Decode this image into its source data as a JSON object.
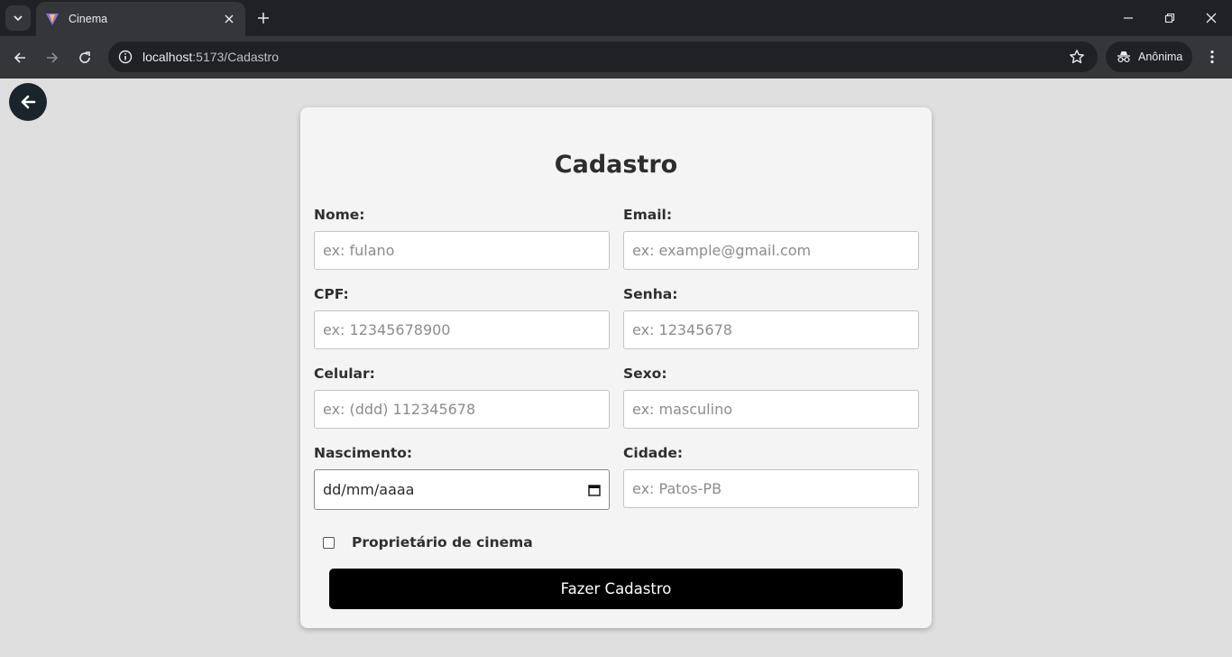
{
  "browser": {
    "tab_title": "Cinema",
    "url_host": "localhost",
    "url_path": ":5173/Cadastro",
    "profile_label": "Anônima"
  },
  "form": {
    "title": "Cadastro",
    "fields": {
      "nome": {
        "label": "Nome:",
        "placeholder": "ex: fulano"
      },
      "email": {
        "label": "Email:",
        "placeholder": "ex: example@gmail.com"
      },
      "cpf": {
        "label": "CPF:",
        "placeholder": "ex: 12345678900"
      },
      "senha": {
        "label": "Senha:",
        "placeholder": "ex: 12345678"
      },
      "celular": {
        "label": "Celular:",
        "placeholder": "ex: (ddd) 112345678"
      },
      "sexo": {
        "label": "Sexo:",
        "placeholder": "ex: masculino"
      },
      "nascimento": {
        "label": "Nascimento:",
        "placeholder": "dd/mm/aaaa"
      },
      "cidade": {
        "label": "Cidade:",
        "placeholder": "ex: Patos-PB"
      }
    },
    "checkbox_label": "Proprietário de cinema",
    "checkbox_checked": false,
    "submit_label": "Fazer Cadastro"
  },
  "colors": {
    "page_bg": "#dfdfdf",
    "card_bg": "#f4f4f4",
    "button_bg": "#000000",
    "back_button_bg": "#1a252b"
  }
}
